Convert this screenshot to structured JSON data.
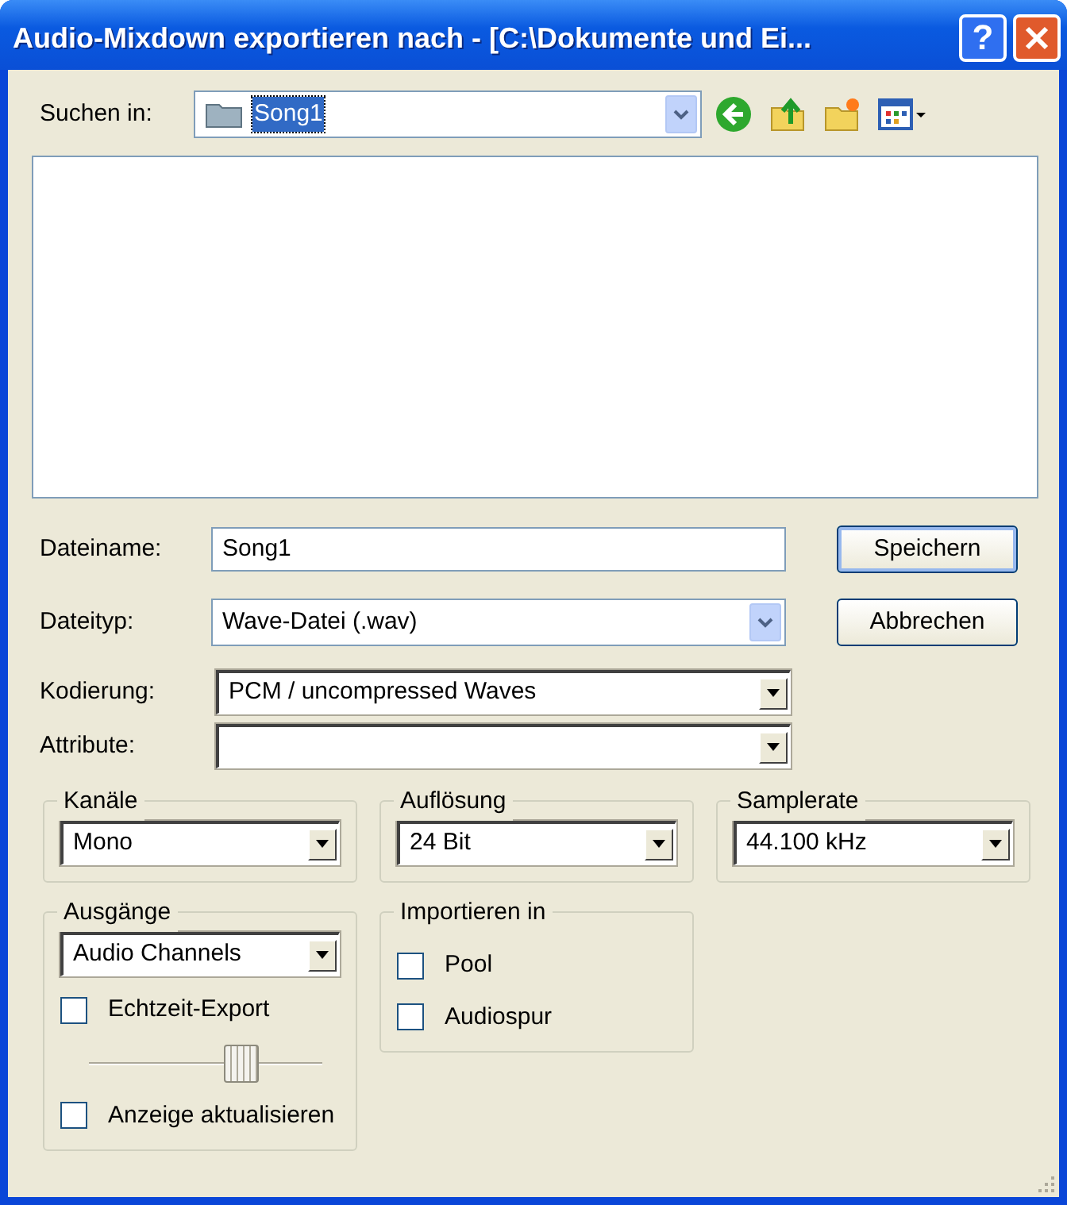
{
  "window": {
    "title": "Audio-Mixdown exportieren nach - [C:\\Dokumente und Ei...",
    "help_label": "?"
  },
  "look_in": {
    "label": "Suchen in:",
    "value": "Song1",
    "value_selected": true
  },
  "fields": [
    {
      "kind": "text",
      "label": "Dateiname:",
      "value": "Song1"
    },
    {
      "kind": "xp_dropdown",
      "label": "Dateityp:",
      "value": "Wave-Datei (.wav)"
    },
    {
      "kind": "dropdown",
      "label": "Kodierung:",
      "value": "PCM / uncompressed Waves"
    },
    {
      "kind": "dropdown",
      "label": "Attribute:"
    }
  ],
  "buttons": [
    {
      "label": "Speichern",
      "default": true
    },
    {
      "label": "Abbrechen",
      "default": false
    }
  ],
  "groups": [
    {
      "title": "Kanäle",
      "items": [
        {
          "kind": "dropdown",
          "value": "Mono"
        }
      ]
    },
    {
      "title": "Auflösung",
      "items": [
        {
          "kind": "dropdown",
          "value": "24 Bit"
        }
      ]
    },
    {
      "title": "Samplerate",
      "items": [
        {
          "kind": "dropdown",
          "value": "44.100 kHz"
        }
      ]
    },
    {
      "title": "Ausgänge",
      "items": [
        {
          "kind": "dropdown",
          "value": "Audio Channels"
        },
        {
          "kind": "checkbox",
          "label": "Echtzeit-Export",
          "checked": false
        },
        {
          "kind": "slider",
          "level": 0.68
        },
        {
          "kind": "checkbox",
          "label": "Anzeige aktualisieren",
          "checked": false
        }
      ]
    },
    {
      "title": "Importieren in",
      "items": [
        {
          "kind": "checkbox",
          "label": "Pool",
          "checked": false
        },
        {
          "kind": "checkbox",
          "label": "Audiospur",
          "checked": false
        }
      ]
    }
  ]
}
